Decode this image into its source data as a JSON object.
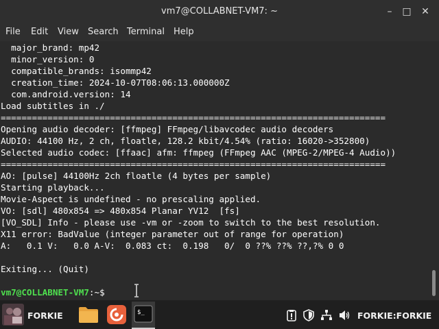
{
  "window": {
    "title": "vm7@COLLABNET-VM7: ~",
    "minimize_glyph": "–",
    "maximize_glyph": "□",
    "close_glyph": "✕"
  },
  "menu": {
    "items": [
      "File",
      "Edit",
      "View",
      "Search",
      "Terminal",
      "Help"
    ]
  },
  "terminal": {
    "lines": [
      "  major_brand: mp42",
      "  minor_version: 0",
      "  compatible_brands: isommp42",
      "  creation_time: 2024-10-07T08:06:13.000000Z",
      "  com.android.version: 14",
      "Load subtitles in ./",
      "==========================================================================",
      "Opening audio decoder: [ffmpeg] FFmpeg/libavcodec audio decoders",
      "AUDIO: 44100 Hz, 2 ch, floatle, 128.2 kbit/4.54% (ratio: 16020->352800)",
      "Selected audio codec: [ffaac] afm: ffmpeg (FFmpeg AAC (MPEG-2/MPEG-4 Audio))",
      "==========================================================================",
      "AO: [pulse] 44100Hz 2ch floatle (4 bytes per sample)",
      "Starting playback...",
      "Movie-Aspect is undefined - no prescaling applied.",
      "VO: [sdl] 480x854 => 480x854 Planar YV12  [fs]",
      "[VO_SDL] Info - please use -vm or -zoom to switch to the best resolution.",
      "X11 error: BadValue (integer parameter out of range for operation)",
      "A:   0.1 V:   0.0 A-V:  0.083 ct:  0.198   0/  0 ??% ??% ??,?% 0 0",
      "",
      "Exiting... (Quit)",
      ""
    ],
    "prompt_user": "vm7@COLLABNET-VM7",
    "prompt_rest": ":~$"
  },
  "taskbar": {
    "start_label": "FORKIE",
    "user_label": "FORKIE:FORKIE",
    "terminal_glyph": "$_"
  },
  "colors": {
    "prompt_green": "#4fe04f",
    "terminal_bg": "#2b2b2b",
    "taskbar_bg": "#1f1f1f",
    "folder_orange": "#e8a33d",
    "firefox_orange": "#e8613c"
  }
}
